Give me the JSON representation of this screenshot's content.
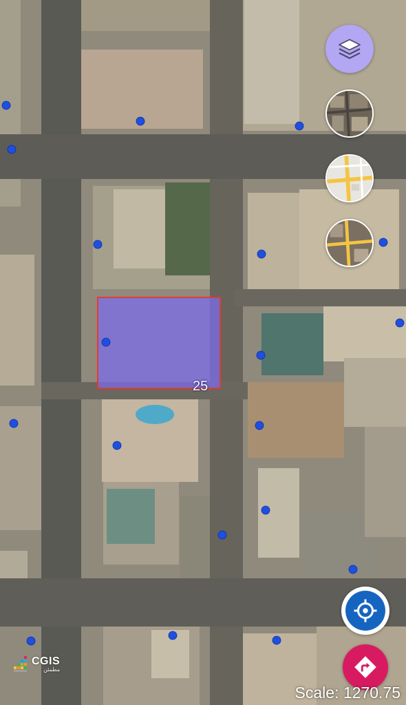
{
  "map": {
    "parcel_number": "25",
    "scale_text": "Scale: 1270.75",
    "marker_color": "#1f4fe0",
    "parcel_fill": "#7b6cf0",
    "parcel_stroke": "#e53935"
  },
  "controls": {
    "layers_icon": "layers-icon",
    "basemaps": [
      "satellite-basemap",
      "street-basemap",
      "hybrid-basemap"
    ],
    "locate_icon": "crosshair-icon",
    "route_icon": "directions-icon",
    "accent_blue": "#1565c0",
    "accent_pink": "#d81b60",
    "layers_bg": "#b3a6f2"
  },
  "logo": {
    "name": "CGIS",
    "subtitle": "مطمئن"
  }
}
